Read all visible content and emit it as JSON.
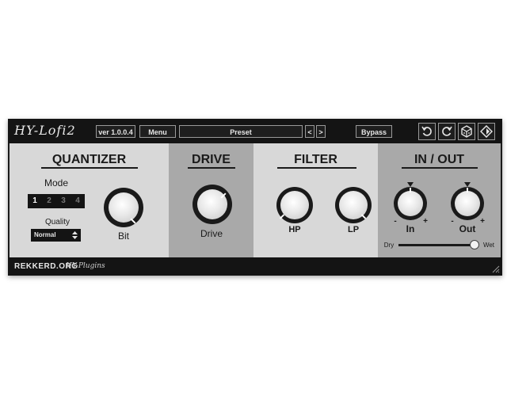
{
  "header": {
    "logo": "HY-Lofi2",
    "version": "ver 1.0.0.4",
    "menu_label": "Menu",
    "preset_label": "Preset",
    "prev_label": "<",
    "next_label": ">",
    "bypass_label": "Bypass",
    "icons": [
      "undo-icon",
      "redo-icon",
      "dice-icon",
      "diamond-icon"
    ]
  },
  "quantizer": {
    "title": "QUANTIZER",
    "mode_label": "Mode",
    "mode_options": [
      "1",
      "2",
      "3",
      "4"
    ],
    "mode_selected": "1",
    "quality_label": "Quality",
    "quality_value": "Normal",
    "bit_label": "Bit"
  },
  "drive": {
    "title": "DRIVE",
    "drive_label": "Drive"
  },
  "filter": {
    "title": "FILTER",
    "hp_label": "HP",
    "lp_label": "LP"
  },
  "inout": {
    "title": "IN / OUT",
    "in_label": "In",
    "out_label": "Out",
    "minus": "-",
    "plus": "+",
    "dry_label": "Dry",
    "wet_label": "Wet",
    "drywet_value": 1.0
  },
  "footer": {
    "brand": "REKKERD.ORG",
    "brand2": "HY-Plugins"
  },
  "colors": {
    "panel_light": "#d8d8d8",
    "panel_dark": "#a9a9a9",
    "bar": "#141414",
    "knob_face": "#e8e8e8"
  }
}
